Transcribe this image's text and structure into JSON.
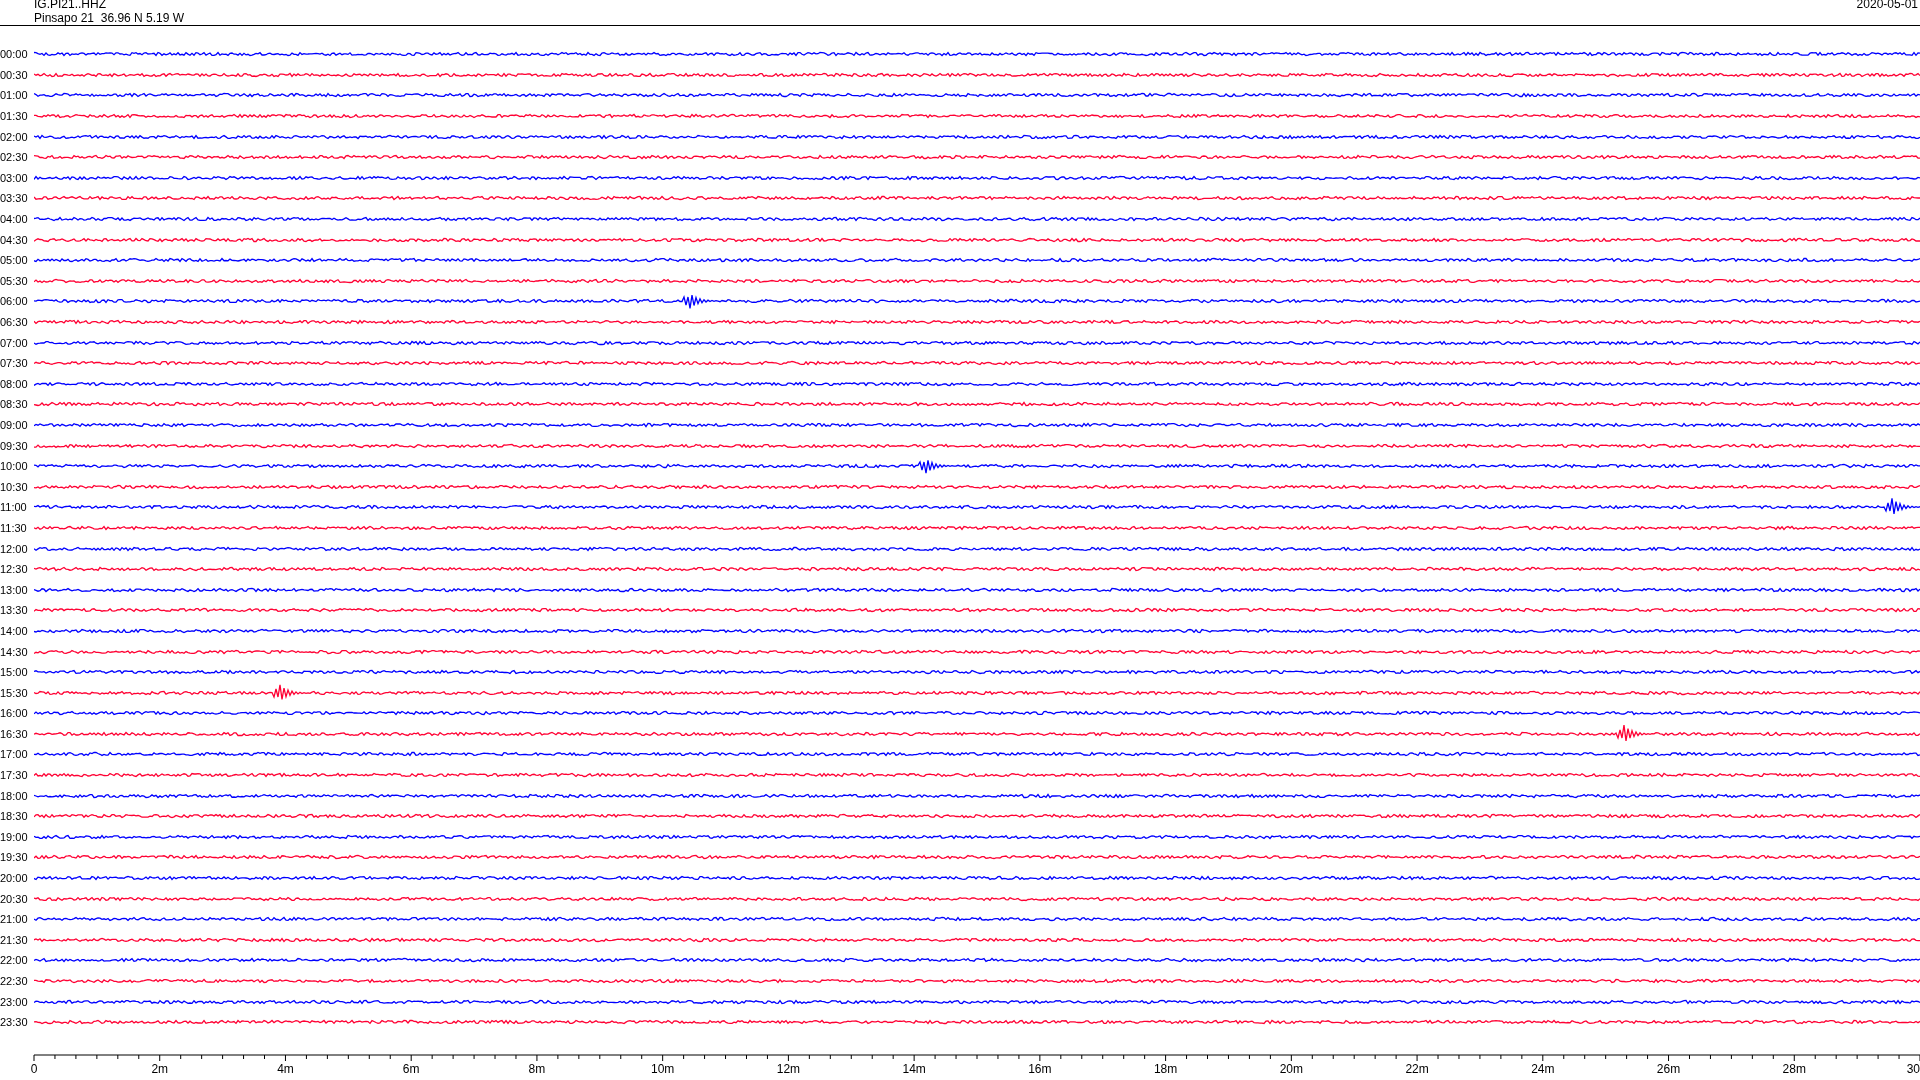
{
  "header": {
    "channel": "IG.PI21..HHZ",
    "station": "Pinsapo 21  36.96 N 5.19 W",
    "date": "2020-05-01"
  },
  "rows": [
    {
      "label": "00:00",
      "color": "#0000ff"
    },
    {
      "label": "00:30",
      "color": "#ff0033"
    },
    {
      "label": "01:00",
      "color": "#0000ff"
    },
    {
      "label": "01:30",
      "color": "#ff0033"
    },
    {
      "label": "02:00",
      "color": "#0000ff"
    },
    {
      "label": "02:30",
      "color": "#ff0033"
    },
    {
      "label": "03:00",
      "color": "#0000ff"
    },
    {
      "label": "03:30",
      "color": "#ff0033"
    },
    {
      "label": "04:00",
      "color": "#0000ff"
    },
    {
      "label": "04:30",
      "color": "#ff0033"
    },
    {
      "label": "05:00",
      "color": "#0000ff"
    },
    {
      "label": "05:30",
      "color": "#ff0033"
    },
    {
      "label": "06:00",
      "color": "#0000ff"
    },
    {
      "label": "06:30",
      "color": "#ff0033"
    },
    {
      "label": "07:00",
      "color": "#0000ff"
    },
    {
      "label": "07:30",
      "color": "#ff0033"
    },
    {
      "label": "08:00",
      "color": "#0000ff"
    },
    {
      "label": "08:30",
      "color": "#ff0033"
    },
    {
      "label": "09:00",
      "color": "#0000ff"
    },
    {
      "label": "09:30",
      "color": "#ff0033"
    },
    {
      "label": "10:00",
      "color": "#0000ff"
    },
    {
      "label": "10:30",
      "color": "#ff0033"
    },
    {
      "label": "11:00",
      "color": "#0000ff"
    },
    {
      "label": "11:30",
      "color": "#ff0033"
    },
    {
      "label": "12:00",
      "color": "#0000ff"
    },
    {
      "label": "12:30",
      "color": "#ff0033"
    },
    {
      "label": "13:00",
      "color": "#0000ff"
    },
    {
      "label": "13:30",
      "color": "#ff0033"
    },
    {
      "label": "14:00",
      "color": "#0000ff"
    },
    {
      "label": "14:30",
      "color": "#ff0033"
    },
    {
      "label": "15:00",
      "color": "#0000ff"
    },
    {
      "label": "15:30",
      "color": "#ff0033"
    },
    {
      "label": "16:00",
      "color": "#0000ff"
    },
    {
      "label": "16:30",
      "color": "#ff0033"
    },
    {
      "label": "17:00",
      "color": "#0000ff"
    },
    {
      "label": "17:30",
      "color": "#ff0033"
    },
    {
      "label": "18:00",
      "color": "#0000ff"
    },
    {
      "label": "18:30",
      "color": "#ff0033"
    },
    {
      "label": "19:00",
      "color": "#0000ff"
    },
    {
      "label": "19:30",
      "color": "#ff0033"
    },
    {
      "label": "20:00",
      "color": "#0000ff"
    },
    {
      "label": "20:30",
      "color": "#ff0033"
    },
    {
      "label": "21:00",
      "color": "#0000ff"
    },
    {
      "label": "21:30",
      "color": "#ff0033"
    },
    {
      "label": "22:00",
      "color": "#0000ff"
    },
    {
      "label": "22:30",
      "color": "#ff0033"
    },
    {
      "label": "23:00",
      "color": "#0000ff"
    },
    {
      "label": "23:30",
      "color": "#ff0033"
    }
  ],
  "axis": {
    "ticks": [
      "0",
      "2m",
      "4m",
      "6m",
      "8m",
      "10m",
      "12m",
      "14m",
      "16m",
      "18m",
      "20m",
      "22m",
      "24m",
      "26m",
      "28m",
      "30"
    ]
  }
}
